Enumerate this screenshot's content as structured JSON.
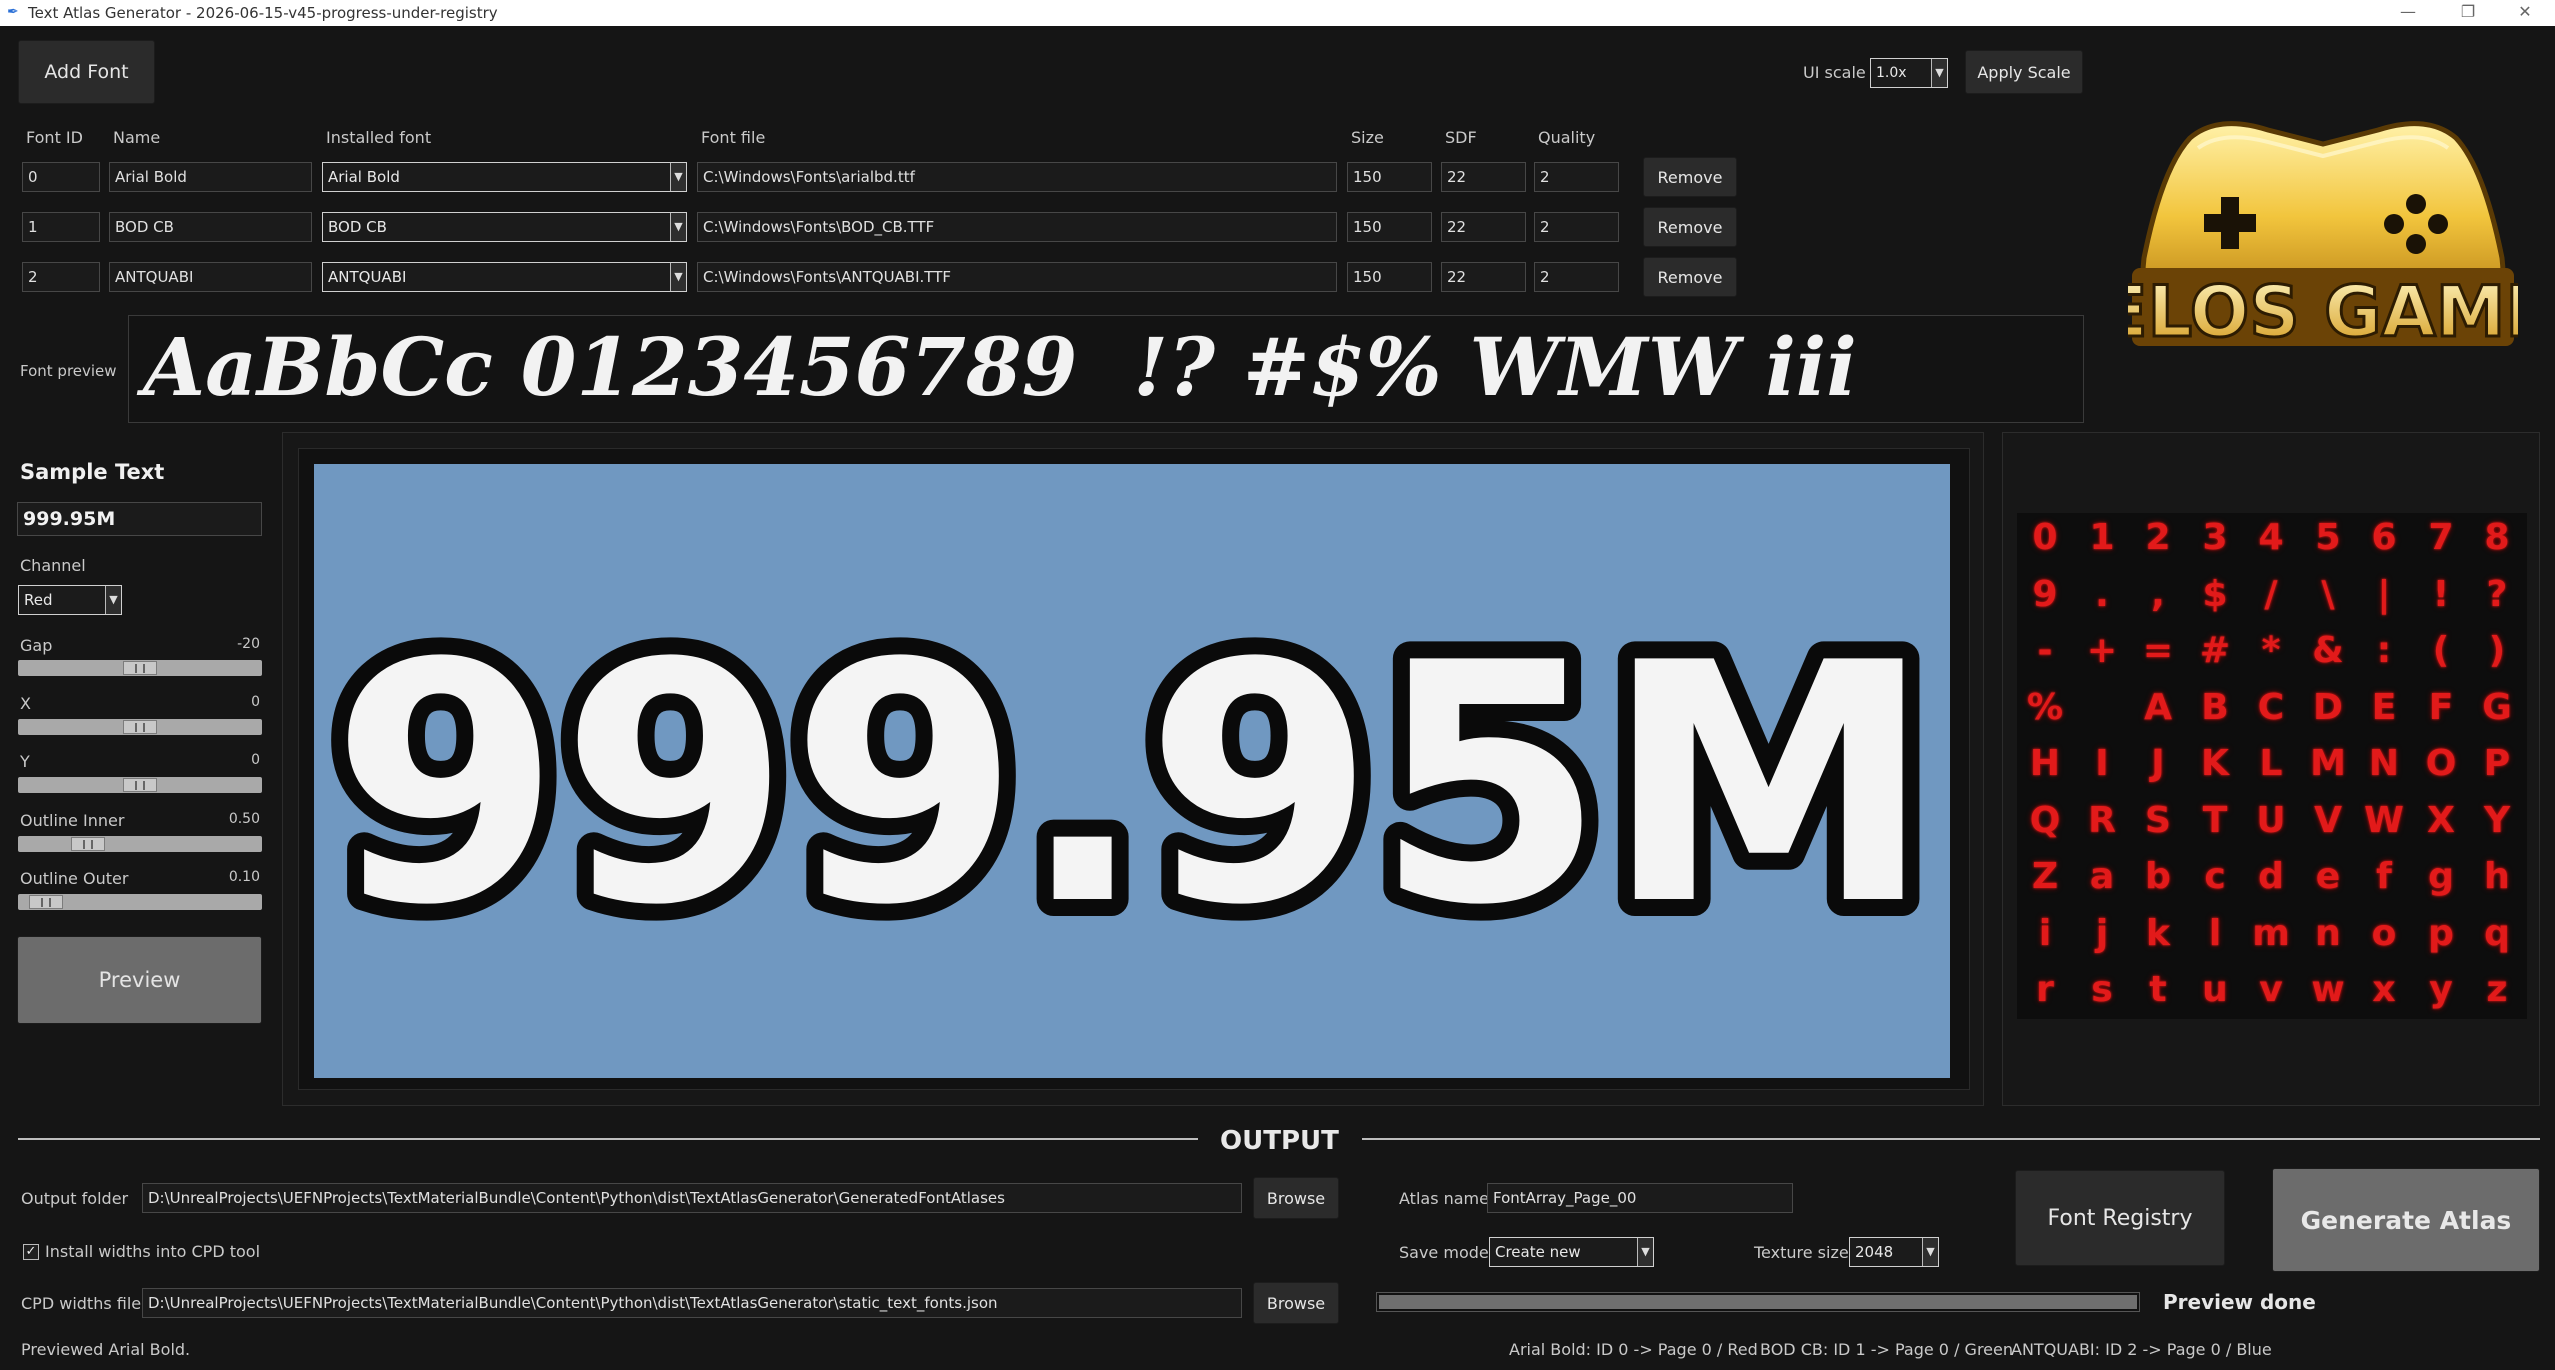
{
  "window": {
    "title": "Text Atlas Generator - 2026-06-15-v45-progress-under-registry",
    "minimize": "—",
    "maximize": "❐",
    "close": "✕"
  },
  "toolbar": {
    "add_font": "Add Font",
    "ui_scale_label": "UI scale",
    "ui_scale_value": "1.0x",
    "apply_scale": "Apply Scale"
  },
  "font_table": {
    "headers": {
      "font_id": "Font ID",
      "name": "Name",
      "installed_font": "Installed font",
      "font_file": "Font file",
      "size": "Size",
      "sdf": "SDF",
      "quality": "Quality"
    },
    "remove_label": "Remove",
    "rows": [
      {
        "id": "0",
        "name": "Arial Bold",
        "installed": "Arial Bold",
        "file": "C:\\Windows\\Fonts\\arialbd.ttf",
        "size": "150",
        "sdf": "22",
        "quality": "2"
      },
      {
        "id": "1",
        "name": "BOD CB",
        "installed": "BOD CB",
        "file": "C:\\Windows\\Fonts\\BOD_CB.TTF",
        "size": "150",
        "sdf": "22",
        "quality": "2"
      },
      {
        "id": "2",
        "name": "ANTQUABI",
        "installed": "ANTQUABI",
        "file": "C:\\Windows\\Fonts\\ANTQUABI.TTF",
        "size": "150",
        "sdf": "22",
        "quality": "2"
      }
    ]
  },
  "font_preview": {
    "label": "Font preview",
    "text": "AaBbCc 0123456789  !? #$% WMW iii"
  },
  "logo": {
    "text": "GELOS GAMES"
  },
  "sample": {
    "heading": "Sample Text",
    "value": "999.95M",
    "channel_label": "Channel",
    "channel_value": "Red",
    "sliders": [
      {
        "label": "Gap",
        "value": "-20",
        "level": 0.5
      },
      {
        "label": "X",
        "value": "0",
        "level": 0.5
      },
      {
        "label": "Y",
        "value": "0",
        "level": 0.5
      },
      {
        "label": "Outline Inner",
        "value": "0.50",
        "level": 0.25
      },
      {
        "label": "Outline Outer",
        "value": "0.10",
        "level": 0.05
      }
    ],
    "preview_button": "Preview"
  },
  "render_preview": {
    "text": "999.95M",
    "background": "#7098c1"
  },
  "atlas": {
    "rows": [
      [
        "0",
        "1",
        "2",
        "3",
        "4",
        "5",
        "6",
        "7",
        "8"
      ],
      [
        "9",
        ".",
        ",",
        "$",
        "/",
        "\\",
        "|",
        "!",
        "?"
      ],
      [
        "-",
        "+",
        "=",
        "#",
        "*",
        "&",
        ":",
        "(",
        ")"
      ],
      [
        "%",
        "",
        "A",
        "B",
        "C",
        "D",
        "E",
        "F",
        "G"
      ],
      [
        "H",
        "I",
        "J",
        "K",
        "L",
        "M",
        "N",
        "O",
        "P"
      ],
      [
        "Q",
        "R",
        "S",
        "T",
        "U",
        "V",
        "W",
        "X",
        "Y"
      ],
      [
        "Z",
        "a",
        "b",
        "c",
        "d",
        "e",
        "f",
        "g",
        "h"
      ],
      [
        "i",
        "j",
        "k",
        "l",
        "m",
        "n",
        "o",
        "p",
        "q"
      ],
      [
        "r",
        "s",
        "t",
        "u",
        "v",
        "w",
        "x",
        "y",
        "z"
      ]
    ],
    "color": "#e21a1a"
  },
  "output": {
    "heading": "OUTPUT",
    "output_folder_label": "Output folder",
    "output_folder": "D:\\UnrealProjects\\UEFNProjects\\TextMaterialBundle\\Content\\Python\\dist\\TextAtlasGenerator\\GeneratedFontAtlases",
    "browse": "Browse",
    "install_widths_label": "Install widths into CPD tool",
    "install_widths_checked": "✓",
    "cpd_label": "CPD widths file",
    "cpd_file": "D:\\UnrealProjects\\UEFNProjects\\TextMaterialBundle\\Content\\Python\\dist\\TextAtlasGenerator\\static_text_fonts.json",
    "atlas_name_label": "Atlas name",
    "atlas_name": "FontArray_Page_00",
    "save_mode_label": "Save mode",
    "save_mode": "Create new",
    "texture_size_label": "Texture size",
    "texture_size": "2048",
    "font_registry": "Font Registry",
    "generate_atlas": "Generate Atlas",
    "progress": 1.0,
    "progress_status": "Preview done"
  },
  "status": {
    "left": "Previewed Arial Bold.",
    "items": [
      "Arial Bold: ID 0 -> Page 0 / Red",
      "BOD CB: ID 1 -> Page 0 / Green",
      "ANTQUABI: ID 2 -> Page 0 / Blue"
    ]
  }
}
